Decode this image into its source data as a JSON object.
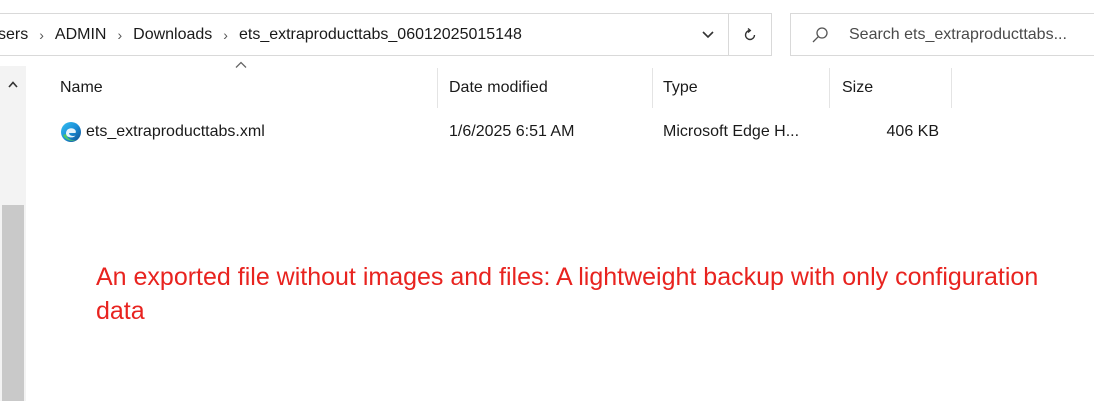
{
  "breadcrumb": {
    "items": [
      "sers",
      "ADMIN",
      "Downloads",
      "ets_extraproducttabs_06012025015148"
    ]
  },
  "search": {
    "placeholder": "Search ets_extraproducttabs..."
  },
  "columns": {
    "name": "Name",
    "date_modified": "Date modified",
    "type": "Type",
    "size": "Size"
  },
  "files": [
    {
      "icon": "microsoft-edge-icon",
      "name": "ets_extraproducttabs.xml",
      "date_modified": "1/6/2025 6:51 AM",
      "type": "Microsoft Edge H...",
      "size": "406 KB"
    }
  ],
  "annotation": {
    "text": "An exported file without images and files: A lightweight backup with only configuration data",
    "color": "#e8231f"
  },
  "icons": {
    "dropdown": "chevron-down-icon",
    "refresh": "refresh-icon",
    "search": "search-icon",
    "sort": "sort-ascending-icon",
    "scroll_up": "scroll-up-icon"
  }
}
